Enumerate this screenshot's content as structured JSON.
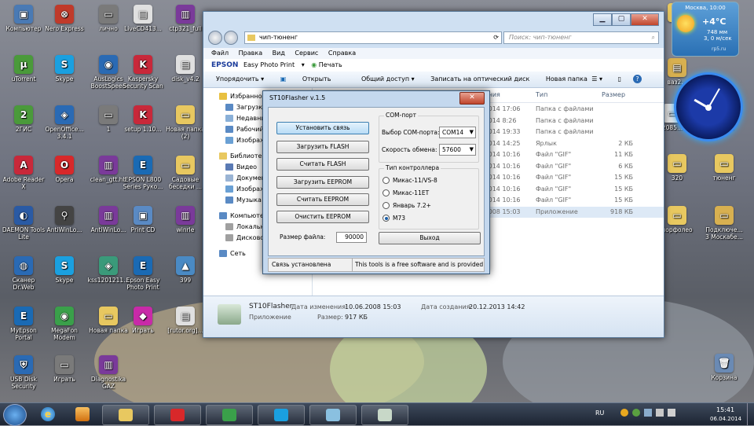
{
  "desktop": {
    "icons": [
      {
        "label": "Компьютер",
        "glyph": "▣",
        "color": "#4a7ab4"
      },
      {
        "label": "Nero Express",
        "glyph": "⊗",
        "color": "#c03a2a"
      },
      {
        "label": "лично",
        "glyph": "▭",
        "color": "#7a7a7a"
      },
      {
        "label": "LiveCD413...",
        "glyph": "▤",
        "color": "#e0e0e0"
      },
      {
        "label": "ctp321_full",
        "glyph": "▥",
        "color": "#7a3a9a"
      },
      {
        "label": "uTorrent",
        "glyph": "µ",
        "color": "#4a9a3a"
      },
      {
        "label": "Skype",
        "glyph": "S",
        "color": "#1aa0e0"
      },
      {
        "label": "AusLogics BoostSpeed",
        "glyph": "◉",
        "color": "#2a6ab4"
      },
      {
        "label": "Kaspersky Security Scan",
        "glyph": "K",
        "color": "#c8283a"
      },
      {
        "label": "disk_v4.2",
        "glyph": "▤",
        "color": "#e0e0e0"
      },
      {
        "label": "2ГИС",
        "glyph": "2",
        "color": "#4a9a3a"
      },
      {
        "label": "OpenOffice... 3.4.1",
        "glyph": "◈",
        "color": "#2a6ab4"
      },
      {
        "label": "1",
        "glyph": "▭",
        "color": "#7a7a7a"
      },
      {
        "label": "setup 1.10...",
        "glyph": "K",
        "color": "#c8283a"
      },
      {
        "label": "Новая папка (2)",
        "glyph": "▭",
        "color": "#e8c860"
      },
      {
        "label": "Adobe Reader X",
        "glyph": "A",
        "color": "#c8283a"
      },
      {
        "label": "Opera",
        "glyph": "O",
        "color": "#d8282a"
      },
      {
        "label": "clean_gtt.hb",
        "glyph": "▥",
        "color": "#7a3a9a"
      },
      {
        "label": "EPSON L800 Series Руко...",
        "glyph": "E",
        "color": "#1a6ab4"
      },
      {
        "label": "Садовые беседки ...",
        "glyph": "▭",
        "color": "#e8c860"
      },
      {
        "label": "DAEMON Tools Lite",
        "glyph": "◐",
        "color": "#2a5aa4"
      },
      {
        "label": "AntiWinLo...",
        "glyph": "⚲",
        "color": "#444444"
      },
      {
        "label": "AntiWinLo...",
        "glyph": "▥",
        "color": "#7a3a9a"
      },
      {
        "label": "Print CD",
        "glyph": "▣",
        "color": "#5a8ac4"
      },
      {
        "label": "winrle",
        "glyph": "▥",
        "color": "#7a3a9a"
      },
      {
        "label": "Сканер Dr.Web",
        "glyph": "◍",
        "color": "#2a6ab4"
      },
      {
        "label": "Skype",
        "glyph": "S",
        "color": "#1aa0e0"
      },
      {
        "label": "kss1201211...",
        "glyph": "◈",
        "color": "#3a9a7a"
      },
      {
        "label": "Epson Easy Photo Print",
        "glyph": "E",
        "color": "#1a6ab4"
      },
      {
        "label": "399",
        "glyph": "▲",
        "color": "#4a8ac4"
      },
      {
        "label": "MyEpson Portal",
        "glyph": "E",
        "color": "#1a6ab4"
      },
      {
        "label": "MegaFon Modem",
        "glyph": "◉",
        "color": "#3aa04a"
      },
      {
        "label": "Новая папка",
        "glyph": "▭",
        "color": "#e8c860"
      },
      {
        "label": "Играть",
        "glyph": "◆",
        "color": "#c82aa8"
      },
      {
        "label": "[rutor.org]...",
        "glyph": "▤",
        "color": "#e0e0e0"
      },
      {
        "label": "USB Disk Security",
        "glyph": "⛨",
        "color": "#2a6ab4"
      },
      {
        "label": "Играть",
        "glyph": "▭",
        "color": "#7a7a7a"
      },
      {
        "label": "Diagnostika GAZ",
        "glyph": "▥",
        "color": "#7a3a9a"
      }
    ],
    "right_icons": [
      {
        "label": "",
        "glyph": "▭",
        "color": "#e8c860"
      },
      {
        "label": "ваз2...",
        "glyph": "▤",
        "color": "#d8b050"
      },
      {
        "label": "2085...",
        "glyph": "▭",
        "color": "#e0e0e0"
      },
      {
        "label": "...61",
        "glyph": "▭",
        "color": "#e0e0e0"
      },
      {
        "label": "320",
        "glyph": "▭",
        "color": "#e8c860"
      },
      {
        "label": "тюненг",
        "glyph": "▭",
        "color": "#e8c860"
      },
      {
        "label": "порфолео",
        "glyph": "▭",
        "color": "#e8c860"
      },
      {
        "label": "Подключе... 3 Москабе...",
        "glyph": "▭",
        "color": "#d8b050"
      },
      {
        "label": "Корзина",
        "glyph": "🗑",
        "color": "#6a8ab4"
      }
    ]
  },
  "weather": {
    "city_time": "Москва, 10:00",
    "temp": "+4°C",
    "pressure": "748 мм",
    "wind": "3, 0 м/сек",
    "source": "rp5.ru"
  },
  "explorer": {
    "address": "чип-тюненг",
    "search_placeholder": "Поиск: чип-тюненг",
    "menu": [
      "Файл",
      "Правка",
      "Вид",
      "Сервис",
      "Справка"
    ],
    "epson": {
      "brand": "EPSON",
      "app": "Easy Photo Print",
      "print": "Печать"
    },
    "commands": [
      "Упорядочить ▾",
      "Открыть",
      "Общий доступ ▾",
      "Записать на оптический диск",
      "Новая папка"
    ],
    "nav": [
      {
        "label": "Избранное",
        "color": "#e8c040"
      },
      {
        "label": "Загрузки",
        "color": "#5a8ac4"
      },
      {
        "label": "Недавние",
        "color": "#8ab0d8"
      },
      {
        "label": "Рабочий",
        "color": "#5a8ac4"
      },
      {
        "label": "Изображ...",
        "color": "#6aa0d4"
      },
      {
        "label": "Библиотек...",
        "color": "#e8c860"
      },
      {
        "label": "Видео",
        "color": "#5a7ab4"
      },
      {
        "label": "Документ...",
        "color": "#9ab4d4"
      },
      {
        "label": "Изображ...",
        "color": "#6aa0d4"
      },
      {
        "label": "Музыка",
        "color": "#5a8ac4"
      },
      {
        "label": "Компьютер",
        "color": "#5a8ac4"
      },
      {
        "label": "Локальны...",
        "color": "#a0a0a0"
      },
      {
        "label": "Дисковод...",
        "color": "#a0a0a0"
      },
      {
        "label": "Сеть",
        "color": "#5a8ac4"
      }
    ],
    "columns": {
      "date": "...ния",
      "type": "Тип",
      "size": "Размер"
    },
    "rows": [
      {
        "date": "...014 17:06",
        "type": "Папка с файлами",
        "size": ""
      },
      {
        "date": "...014 8:26",
        "type": "Папка с файлами",
        "size": ""
      },
      {
        "date": "...014 19:33",
        "type": "Папка с файлами",
        "size": ""
      },
      {
        "date": "...014 14:25",
        "type": "Ярлык",
        "size": "2 КБ"
      },
      {
        "date": "...014 10:16",
        "type": "Файл \"GIF\"",
        "size": "11 КБ"
      },
      {
        "date": "...014 10:16",
        "type": "Файл \"GIF\"",
        "size": "6 КБ"
      },
      {
        "date": "...014 10:16",
        "type": "Файл \"GIF\"",
        "size": "15 КБ"
      },
      {
        "date": "...014 10:16",
        "type": "Файл \"GIF\"",
        "size": "15 КБ"
      },
      {
        "date": "...014 10:16",
        "type": "Файл \"GIF\"",
        "size": "15 КБ"
      },
      {
        "date": "...008 15:03",
        "type": "Приложение",
        "size": "918 КБ"
      }
    ],
    "details": {
      "name": "ST10Flasher",
      "kind": "Приложение",
      "modified_label": "Дата изменения:",
      "modified": "10.06.2008 15:03",
      "size_label": "Размер:",
      "size": "917 КБ",
      "created_label": "Дата создания:",
      "created": "20.12.2013 14:42"
    }
  },
  "dialog": {
    "title": "ST10Flasher v.1.5",
    "close": "✕",
    "buttons": [
      "Установить связь",
      "Загрузить FLASH",
      "Считать FLASH",
      "Загрузить EEPROM",
      "Считать EEPROM",
      "Очистить EEPROM"
    ],
    "com_group": "COM-порт",
    "com_port_label": "Выбор COM-порта:",
    "com_port_value": "COM14",
    "baud_label": "Скорость обмена:",
    "baud_value": "57600",
    "ctrl_group": "Тип контроллера",
    "controllers": [
      {
        "label": "Микас-11/VS-8",
        "selected": false
      },
      {
        "label": "Микас-11ET",
        "selected": false
      },
      {
        "label": "Январь 7.2+",
        "selected": false
      },
      {
        "label": "M73",
        "selected": true
      }
    ],
    "filesize_label": "Размер файла:",
    "filesize_value": "90000",
    "exit": "Выход",
    "status_left": "Связь установлена",
    "status_right": "This tools is a free software and is provided as"
  },
  "taskbar": {
    "lang": "RU",
    "time": "15:41",
    "date": "06.04.2014",
    "items": [
      {
        "name": "explorer",
        "color": "#e8c860"
      },
      {
        "name": "opera",
        "color": "#d8282a"
      },
      {
        "name": "icq",
        "color": "#3aa04a"
      },
      {
        "name": "skype",
        "color": "#1aa0e0"
      },
      {
        "name": "notepad",
        "color": "#8ac0e0"
      },
      {
        "name": "st10flasher",
        "color": "#c8d8c8"
      }
    ]
  }
}
